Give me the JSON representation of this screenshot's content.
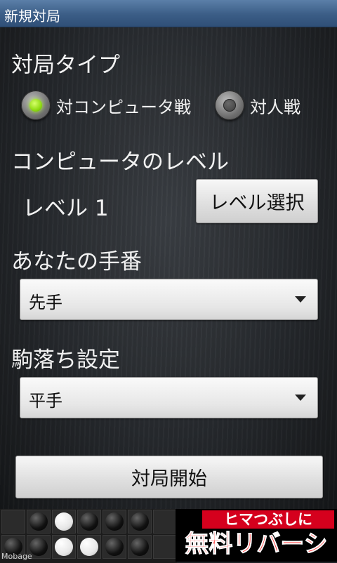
{
  "titlebar": {
    "title": "新規対局"
  },
  "game_type": {
    "heading": "対局タイプ",
    "options": [
      {
        "label": "対コンピュータ戦",
        "selected": true
      },
      {
        "label": "対人戦",
        "selected": false
      }
    ]
  },
  "computer_level": {
    "heading": "コンピュータのレベル",
    "current": "レベル 1",
    "select_button": "レベル選択"
  },
  "turn": {
    "heading": "あなたの手番",
    "selected": "先手"
  },
  "handicap": {
    "heading": "駒落ち設定",
    "selected": "平手"
  },
  "start_button": "対局開始",
  "ad": {
    "brand": "Mobage",
    "line1": "ヒマつぶしに",
    "line2": "無料リバーシ"
  },
  "colors": {
    "titlebar": "#3b5d86",
    "radio_selected": "#8fdb12",
    "ad_red": "#d5001d"
  }
}
